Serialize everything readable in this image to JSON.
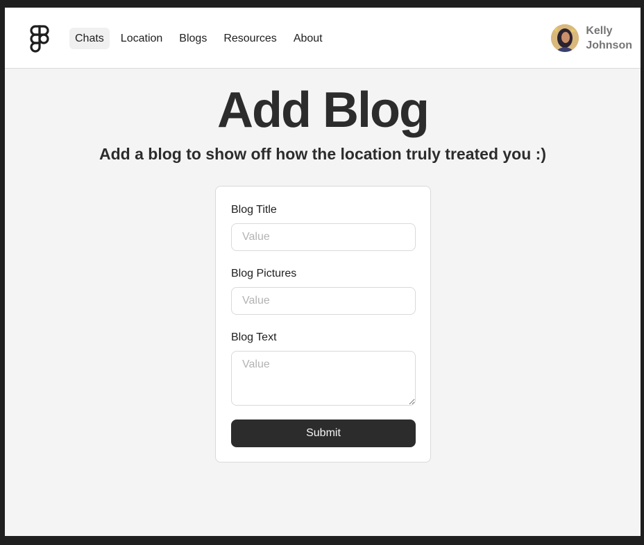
{
  "nav": {
    "items": [
      {
        "label": "Chats",
        "active": true
      },
      {
        "label": "Location"
      },
      {
        "label": "Blogs"
      },
      {
        "label": "Resources"
      },
      {
        "label": "About"
      }
    ]
  },
  "user": {
    "first_name": "Kelly",
    "last_name": "Johnson"
  },
  "hero": {
    "title": "Add Blog",
    "subtitle": "Add a blog to show off how the location truly treated you :)"
  },
  "form": {
    "title_label": "Blog Title",
    "title_placeholder": "Value",
    "pictures_label": "Blog Pictures",
    "pictures_placeholder": "Value",
    "text_label": "Blog Text",
    "text_placeholder": "Value",
    "submit_label": "Submit"
  },
  "colors": {
    "page_bg": "#f4f4f4",
    "primary": "#2c2c2c",
    "border": "#d9d9d9"
  }
}
